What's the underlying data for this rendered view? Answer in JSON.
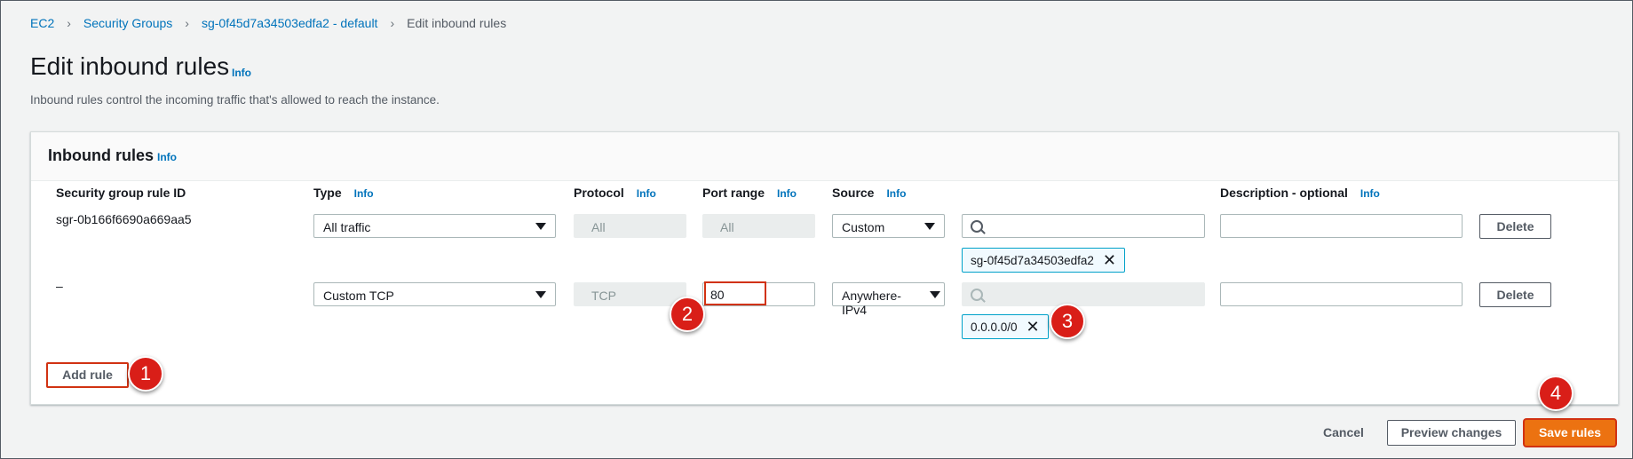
{
  "breadcrumb": {
    "items": [
      "EC2",
      "Security Groups",
      "sg-0f45d7a34503edfa2 - default"
    ],
    "current": "Edit inbound rules"
  },
  "page": {
    "title": "Edit inbound rules",
    "info": "Info",
    "description": "Inbound rules control the incoming traffic that's allowed to reach the instance."
  },
  "panel": {
    "title": "Inbound rules",
    "info": "Info",
    "columns": {
      "rule_id": "Security group rule ID",
      "type": "Type",
      "protocol": "Protocol",
      "port_range": "Port range",
      "source": "Source",
      "description": "Description - optional",
      "info": "Info"
    },
    "rows": [
      {
        "rule_id": "sgr-0b166f6690a669aa5",
        "type": "All traffic",
        "protocol": "All",
        "port_range": "All",
        "source": "Custom",
        "source_search": "",
        "token": "sg-0f45d7a34503edfa2",
        "description": "",
        "delete": "Delete"
      },
      {
        "rule_id": "–",
        "type": "Custom TCP",
        "protocol": "TCP",
        "port_range": "80",
        "source": "Anywhere-IPv4",
        "source_search": "",
        "token": "0.0.0.0/0",
        "description": "",
        "delete": "Delete"
      }
    ],
    "add_rule": "Add rule"
  },
  "footer": {
    "cancel": "Cancel",
    "preview": "Preview changes",
    "save": "Save rules"
  },
  "annotations": [
    "1",
    "2",
    "3",
    "4"
  ],
  "colors": {
    "link": "#0073bb",
    "primary": "#ec7211",
    "annotation": "#d91e18",
    "token_border": "#00a1c9"
  }
}
